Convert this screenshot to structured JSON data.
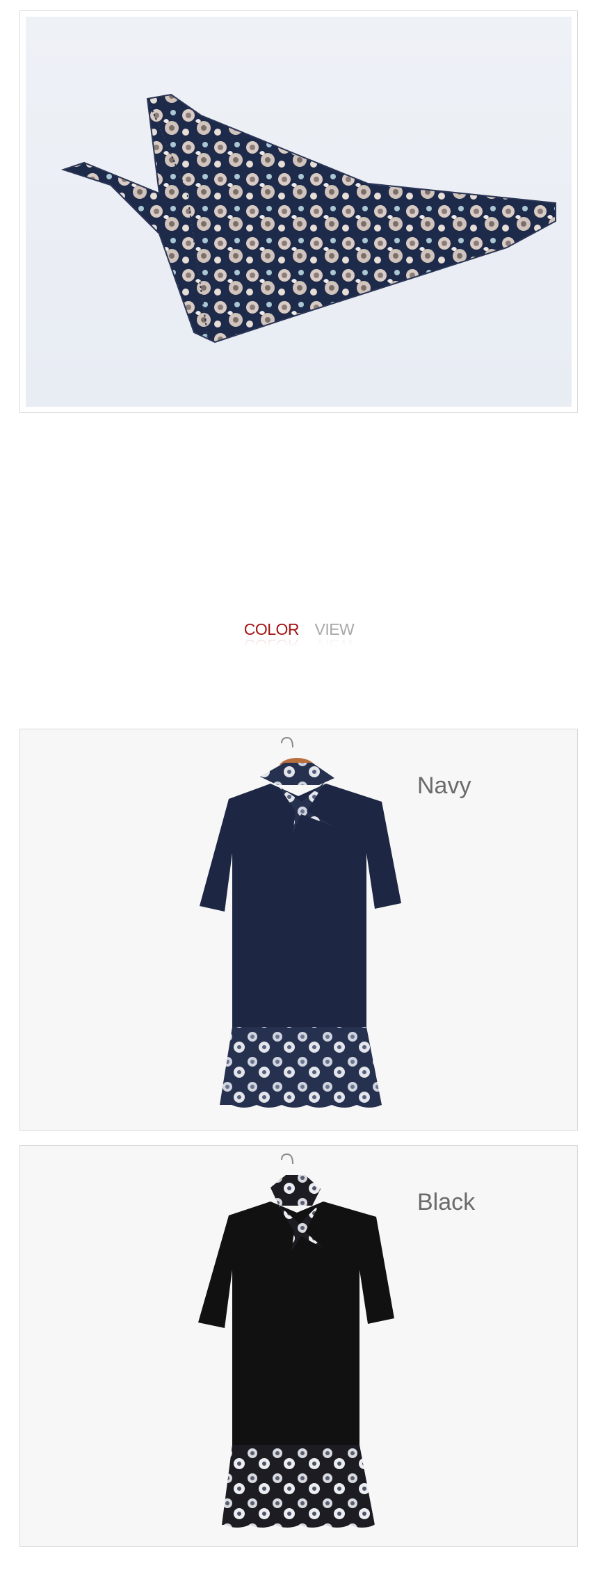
{
  "section_heading": {
    "word_1": "COLOR",
    "word_2": "VIEW",
    "colors": {
      "word_1": "#a31313",
      "word_2": "#a8a8a8"
    }
  },
  "variants": [
    {
      "label": "Navy",
      "body_color": "#1d2744"
    },
    {
      "label": "Black",
      "body_color": "#111111"
    }
  ],
  "scarf": {
    "print_base": "#1e2a4a",
    "print_flower": "#d8ccc4"
  }
}
